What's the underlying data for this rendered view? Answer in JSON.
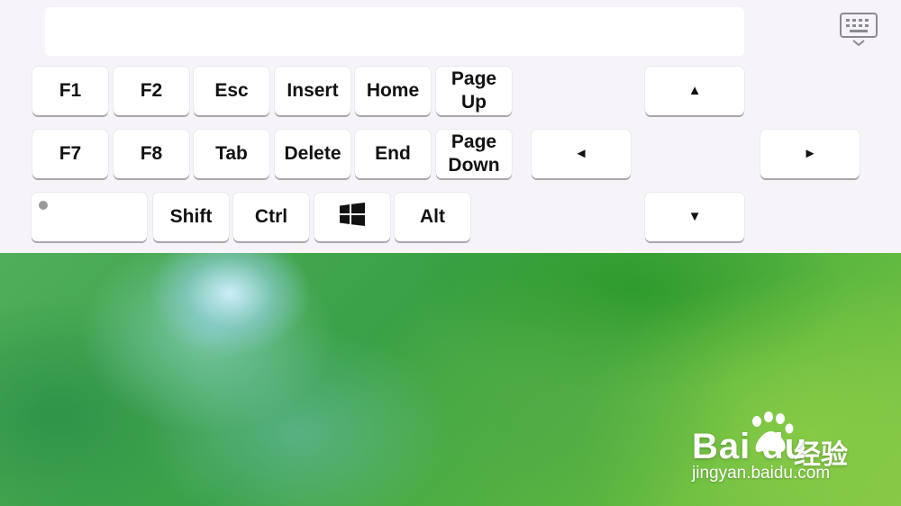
{
  "keyboard": {
    "toggle_icon": "keyboard-hide-icon",
    "row1": [
      "F1",
      "F2",
      "Esc",
      "Insert",
      "Home",
      "Page Up"
    ],
    "row2": [
      "F7",
      "F8",
      "Tab",
      "Delete",
      "End",
      "Page Down"
    ],
    "row3": [
      "Shift",
      "Ctrl",
      "Alt"
    ],
    "windows_icon": "windows-logo-icon",
    "arrows": {
      "up": "▲",
      "down": "▼",
      "left": "◄",
      "right": "►"
    }
  },
  "watermark": {
    "logo": "Bai  du",
    "suffix": "经验",
    "url": "jingyan.baidu.com"
  },
  "colors": {
    "panel_bg": "#f6f3f9",
    "key_bg": "#ffffff",
    "key_text": "#111111"
  }
}
